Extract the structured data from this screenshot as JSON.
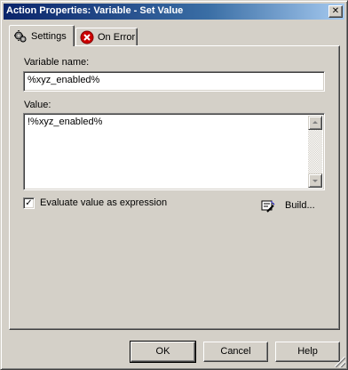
{
  "window": {
    "title": "Action Properties: Variable - Set Value",
    "close_glyph": "✕"
  },
  "tabs": [
    {
      "label": "Settings",
      "icon": "gears-icon",
      "active": true
    },
    {
      "label": "On Error",
      "icon": "error-x-icon",
      "active": false
    }
  ],
  "settings": {
    "variable_name_label": "Variable name:",
    "variable_name_value": "%xyz_enabled%",
    "value_label": "Value:",
    "value_text": "!%xyz_enabled%",
    "evaluate_checkbox_label": "Evaluate value as expression",
    "evaluate_checked": true,
    "build_label": "Build..."
  },
  "footer": {
    "ok_label": "OK",
    "cancel_label": "Cancel",
    "help_label": "Help"
  },
  "colors": {
    "face": "#d4d0c8",
    "titlebar_start": "#0a246a",
    "titlebar_end": "#a6caf0",
    "error_red": "#cc0000"
  }
}
